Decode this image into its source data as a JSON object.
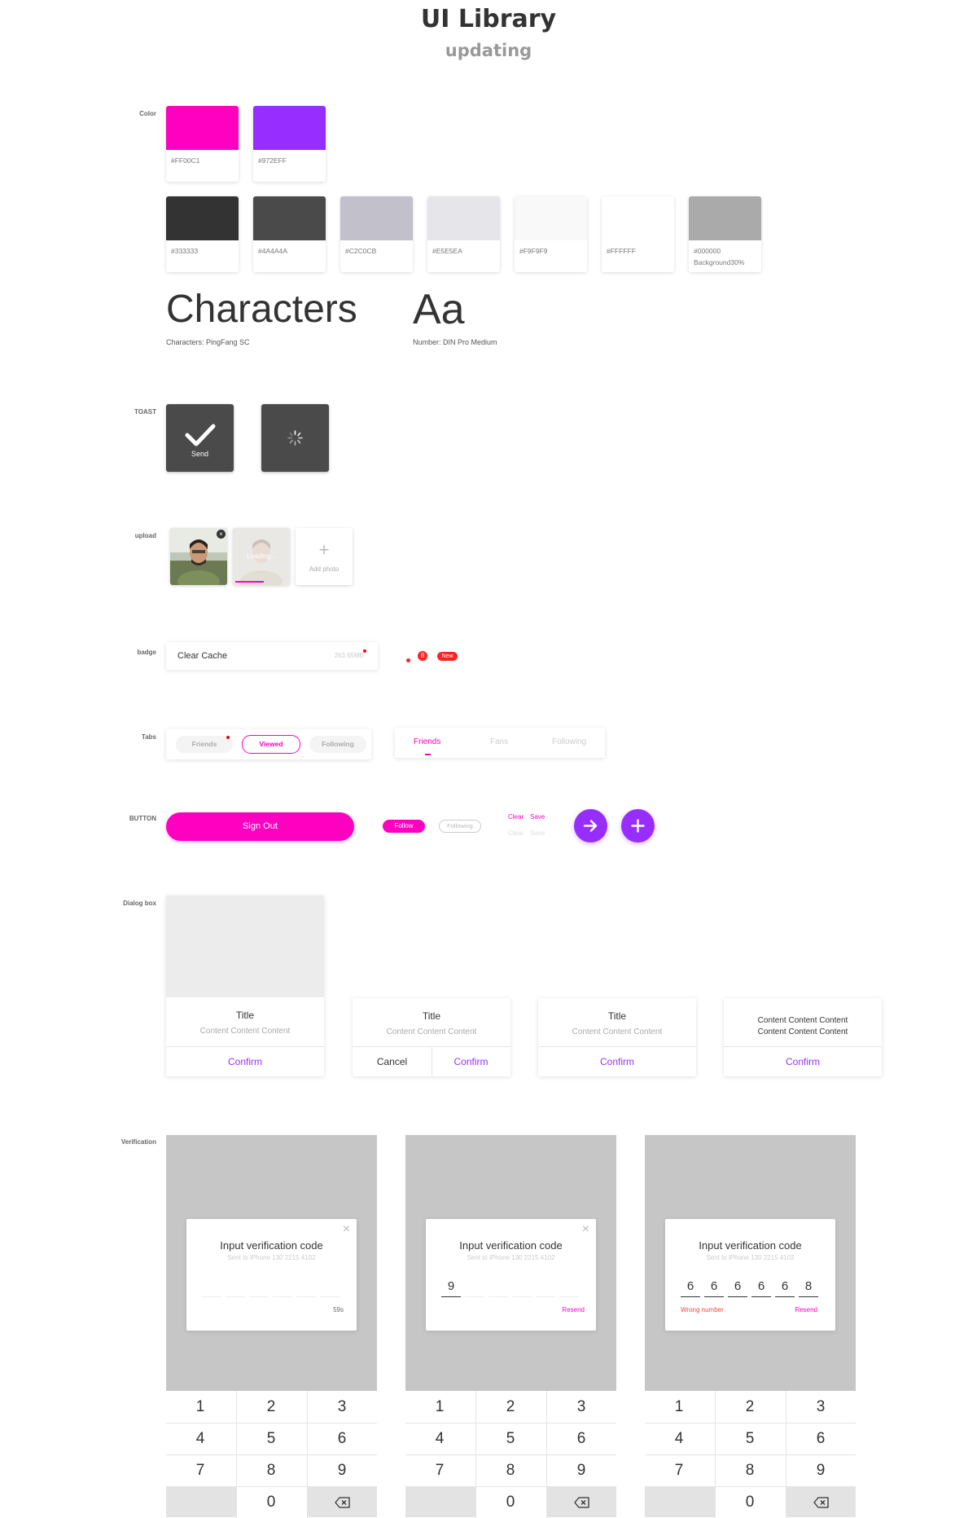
{
  "header": {
    "title": "UI Library",
    "subtitle": "updating"
  },
  "sections": {
    "color": "Color",
    "toast": "TOAST",
    "upload": "upload",
    "badge": "badge",
    "tabs": "Tabs",
    "button": "BUTTON",
    "dialog": "Dialog box",
    "verification": "Verification"
  },
  "colors": {
    "primary": [
      {
        "hex": "#FF00C1",
        "label": "#FF00C1"
      },
      {
        "hex": "#972EFF",
        "label": "#972EFF"
      }
    ],
    "neutral": [
      {
        "hex": "#333333",
        "label": "#333333"
      },
      {
        "hex": "#4A4A4A",
        "label": "#4A4A4A"
      },
      {
        "hex": "#C2C0CB",
        "label": "#C2C0CB"
      },
      {
        "hex": "#E5E5EA",
        "label": "#E5E5EA"
      },
      {
        "hex": "#F9F9F9",
        "label": "#F9F9F9"
      },
      {
        "hex": "#FFFFFF",
        "label": "#FFFFFF"
      },
      {
        "hex": "#AAAAAA",
        "label": "#000000",
        "label2": "Background30%"
      }
    ]
  },
  "typography": {
    "characters": "Characters",
    "characters_caption": "Characters: PingFang SC",
    "number": "Aa",
    "number_caption": "Number: DIN Pro  Medium"
  },
  "toast": {
    "send_label": "Send"
  },
  "upload": {
    "loading": "Loading...",
    "add_photo": "Add photo",
    "progress": 0.55
  },
  "badge": {
    "clear_cache": "Clear Cache",
    "cache_size": "263.65MB",
    "count": "8",
    "new_label": "New"
  },
  "tabs": {
    "pill": [
      "Friends",
      "Viewed",
      "Following"
    ],
    "underline": [
      "Friends",
      "Fans",
      "Following"
    ]
  },
  "buttons": {
    "sign_out": "Sign Out",
    "follow": "Follow",
    "following": "Following",
    "clear": "Clear",
    "save": "Save",
    "clear_disabled": "Clear",
    "save_disabled": "Save",
    "arrow_icon": "→",
    "plus_icon": "+"
  },
  "dialogs": {
    "d1": {
      "title": "Title",
      "content": "Content Content Content",
      "confirm": "Confirm"
    },
    "d2": {
      "title": "Title",
      "content": "Content Content Content",
      "cancel": "Cancel",
      "confirm": "Confirm"
    },
    "d3": {
      "title": "Title",
      "content": "Content Content Content",
      "confirm": "Confirm"
    },
    "d4": {
      "line1": "Content Content Content",
      "line2": "Content Content Content",
      "confirm": "Confirm"
    }
  },
  "verification": {
    "title": "Input verification code",
    "sent_to": "Sent to iPhone  130 2215 4102",
    "p1": {
      "digits": [
        "",
        "",
        "",
        "",
        "",
        ""
      ],
      "right": "59s",
      "left": ""
    },
    "p2": {
      "digits": [
        "9",
        "",
        "",
        "",
        "",
        ""
      ],
      "right": "Resend",
      "left": ""
    },
    "p3": {
      "digits": [
        "6",
        "6",
        "6",
        "6",
        "6",
        "8"
      ],
      "right": "Resend",
      "left": "Wrong number"
    },
    "keys": [
      "1",
      "2",
      "3",
      "4",
      "5",
      "6",
      "7",
      "8",
      "9",
      "0"
    ]
  },
  "palette": {
    "pink": "#FF00C1",
    "purple": "#972EFF",
    "dark": "#333333"
  }
}
